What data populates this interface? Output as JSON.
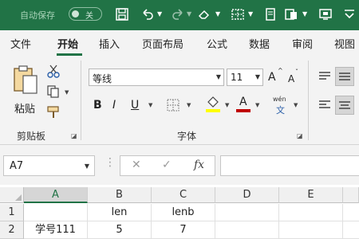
{
  "titlebar": {
    "autosave_label": "自动保存",
    "autosave_state": "关",
    "icons": [
      "save-icon",
      "undo-icon",
      "redo-icon",
      "eraser-icon",
      "border-icon",
      "format-icon",
      "fill-icon",
      "screen-icon",
      "more-icon"
    ]
  },
  "tabs": [
    "文件",
    "开始",
    "插入",
    "页面布局",
    "公式",
    "数据",
    "审阅",
    "视图"
  ],
  "active_tab": "开始",
  "ribbon": {
    "clipboard": {
      "paste_label": "粘贴",
      "group_label": "剪贴板"
    },
    "font": {
      "font_name": "等线",
      "font_size": "11",
      "grow_label": "A",
      "shrink_label": "A",
      "bold": "B",
      "italic": "I",
      "underline": "U",
      "font_color_label": "A",
      "phonetic_top": "wén",
      "phonetic_bottom": "文",
      "group_label": "字体"
    }
  },
  "formula_bar": {
    "name_box": "A7",
    "cancel": "✕",
    "confirm": "✓",
    "fx": "fx",
    "value": ""
  },
  "sheet": {
    "columns": [
      "A",
      "B",
      "C",
      "D",
      "E"
    ],
    "selected_column": "A",
    "rows": [
      {
        "num": "1",
        "cells": [
          "",
          "len",
          "lenb",
          "",
          ""
        ]
      },
      {
        "num": "2",
        "cells": [
          "学号111",
          "5",
          "7",
          "",
          ""
        ]
      }
    ]
  },
  "colors": {
    "brand": "#217346",
    "highlight_yellow": "#ffff00",
    "font_red": "#c00000"
  }
}
